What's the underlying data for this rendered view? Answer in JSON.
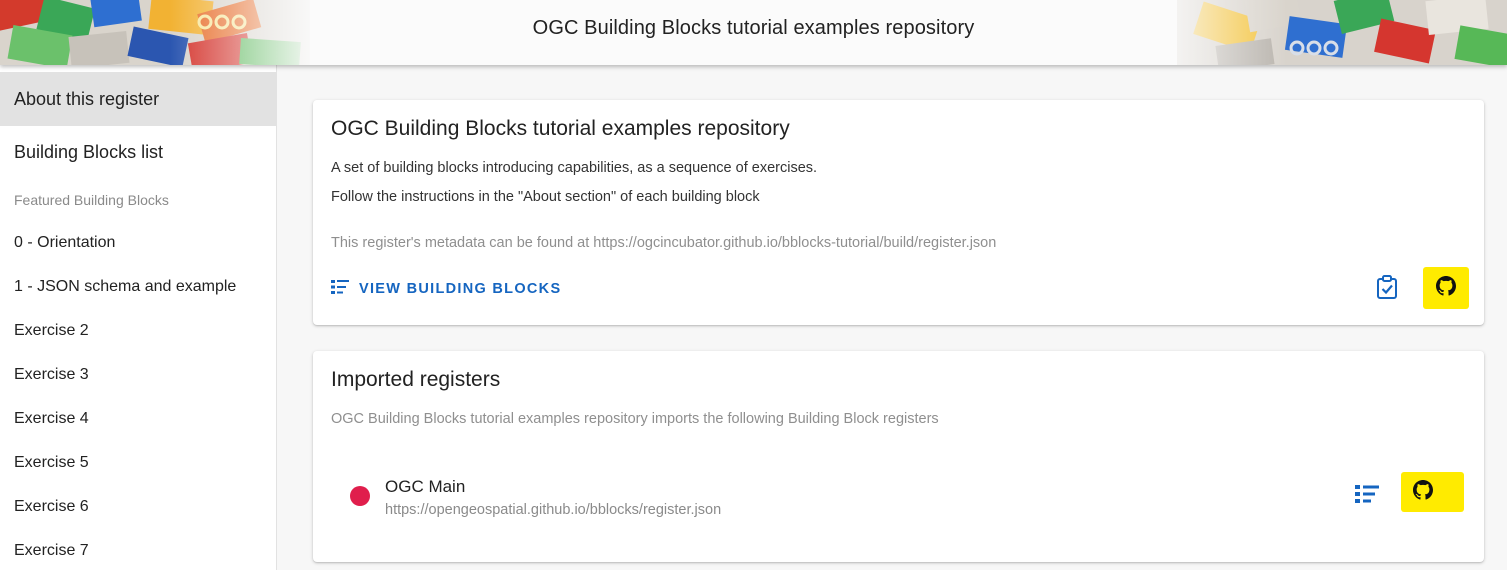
{
  "header": {
    "title": "OGC Building Blocks tutorial examples repository"
  },
  "sidebar": {
    "items": [
      {
        "label": "About this register",
        "active": true
      },
      {
        "label": "Building Blocks list",
        "active": false
      }
    ],
    "section_label": "Featured Building Blocks",
    "featured": [
      "0 - Orientation",
      "1 - JSON schema and example",
      "Exercise 2",
      "Exercise 3",
      "Exercise 4",
      "Exercise 5",
      "Exercise 6",
      "Exercise 7"
    ]
  },
  "register_card": {
    "title": "OGC Building Blocks tutorial examples repository",
    "description_1": "A set of building blocks introducing capabilities, as a sequence of exercises.",
    "description_2": "Follow the instructions in the \"About section\" of each building block",
    "metadata_text": "This register's metadata can be found at https://ogcincubator.github.io/bblocks-tutorial/build/register.json",
    "view_button_label": "VIEW BUILDING BLOCKS",
    "view_button_icon": "list-icon",
    "validation_icon": "clipboard-check-icon",
    "github_icon": "github-icon"
  },
  "imports_card": {
    "title": "Imported registers",
    "subtitle": "OGC Building Blocks tutorial examples repository imports the following Building Block registers",
    "registers": [
      {
        "name": "OGC Main",
        "url": "https://opengeospatial.github.io/bblocks/register.json",
        "dot_color": "#e01e4c",
        "list_icon": "list-icon",
        "github_icon": "github-icon"
      }
    ]
  },
  "colors": {
    "accent": "#1565c0",
    "highlight": "#ffeb00",
    "active_nav": "#e2e2e2"
  }
}
